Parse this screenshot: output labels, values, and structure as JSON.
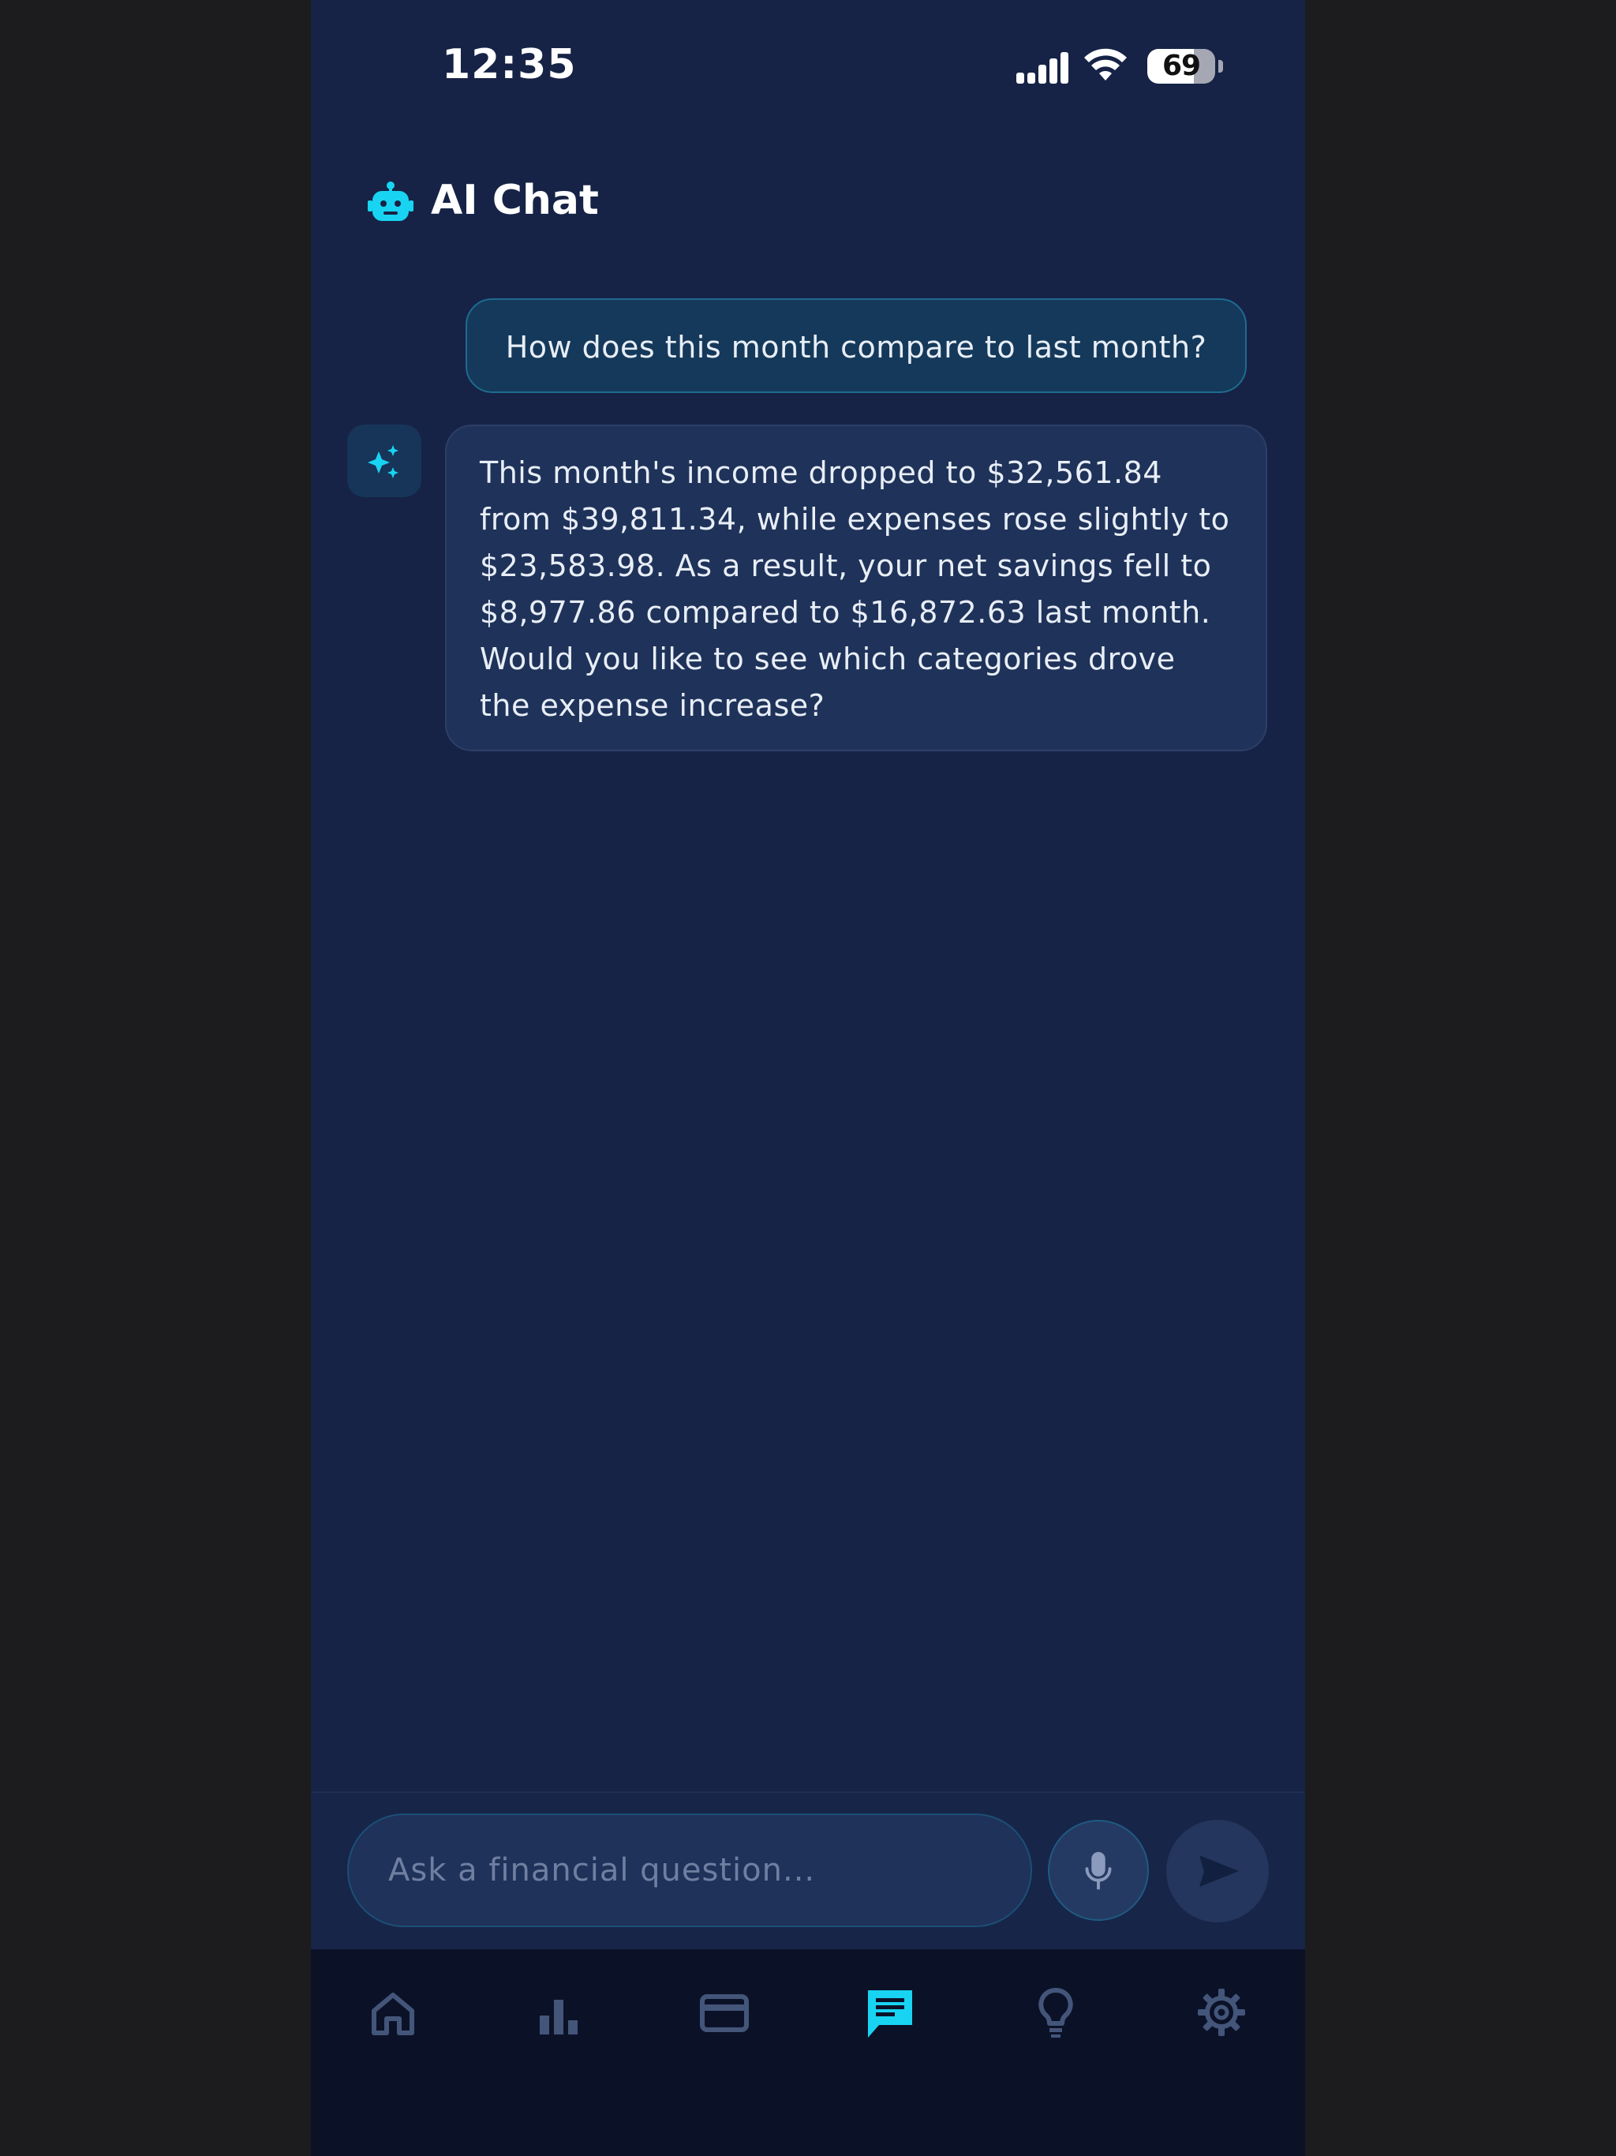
{
  "status_bar": {
    "time": "12:35",
    "battery_percent": "69",
    "signal_icon": "cellular-signal-icon",
    "wifi_icon": "wifi-icon"
  },
  "header": {
    "title": "AI Chat",
    "icon": "robot-icon"
  },
  "messages": [
    {
      "role": "user",
      "text": "How does this month compare to last month?"
    },
    {
      "role": "assistant",
      "avatar_icon": "sparkles-icon",
      "text": "This month's income dropped to $32,561.84 from $39,811.34, while expenses rose slightly to $23,583.98. As a result, your net savings fell to $8,977.86 compared to $16,872.63 last month. Would you like to see which categories drove the expense increase?"
    }
  ],
  "composer": {
    "placeholder": "Ask a financial question...",
    "value": "",
    "mic_icon": "microphone-icon",
    "send_icon": "send-icon"
  },
  "bottom_nav": {
    "items": [
      {
        "id": "home",
        "icon": "home-icon",
        "active": false
      },
      {
        "id": "analytics",
        "icon": "bar-chart-icon",
        "active": false
      },
      {
        "id": "cards",
        "icon": "credit-card-icon",
        "active": false
      },
      {
        "id": "chat",
        "icon": "chat-icon",
        "active": true
      },
      {
        "id": "insights",
        "icon": "lightbulb-icon",
        "active": false
      },
      {
        "id": "settings",
        "icon": "gear-icon",
        "active": false
      }
    ]
  },
  "colors": {
    "background": "#162346",
    "accent": "#18d4f2",
    "nav_inactive": "#44557a",
    "bubble_user": "#15395a",
    "bubble_ai": "#1f3259"
  }
}
